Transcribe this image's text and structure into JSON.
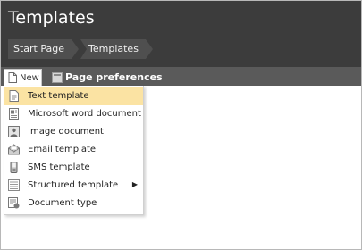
{
  "header": {
    "title": "Templates"
  },
  "breadcrumb": [
    "Start Page",
    "Templates"
  ],
  "toolbar": {
    "new_label": "New",
    "page_preferences_label": "Page preferences"
  },
  "menu": {
    "items": [
      {
        "label": "Text template",
        "icon": "text-template-icon",
        "highlighted": true
      },
      {
        "label": "Microsoft word document",
        "icon": "word-document-icon"
      },
      {
        "label": "Image document",
        "icon": "image-document-icon"
      },
      {
        "label": "Email template",
        "icon": "email-template-icon"
      },
      {
        "label": "SMS template",
        "icon": "sms-template-icon"
      },
      {
        "label": "Structured template",
        "icon": "structured-template-icon",
        "has_submenu": true
      },
      {
        "label": "Document type",
        "icon": "document-type-icon"
      }
    ]
  },
  "colors": {
    "header": "#3c3c3c",
    "toolbar": "#5a5a5a",
    "highlight": "#fbe3a3"
  }
}
